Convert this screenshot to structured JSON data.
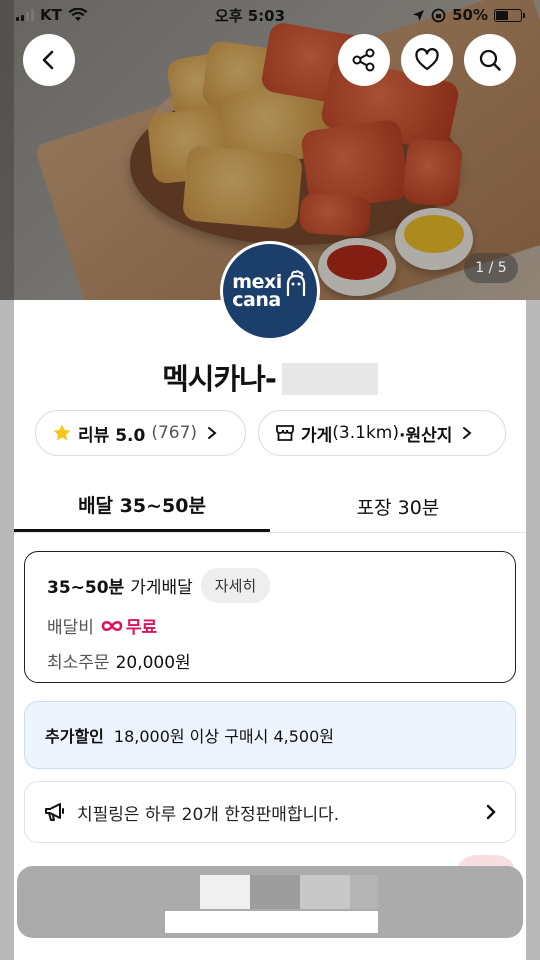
{
  "status_bar": {
    "carrier": "KT",
    "time": "오후 5:03",
    "battery": "50%"
  },
  "hero": {
    "image_counter": "1 / 5"
  },
  "store": {
    "logo_line1": "mexi",
    "logo_line2": "cana",
    "name": "멕시카나-"
  },
  "review_pill": {
    "label": "리뷰 5.0",
    "count": "(767)"
  },
  "store_pill": {
    "label_prefix": "가게",
    "distance": "(3.1km)",
    "label_suffix": "·원산지"
  },
  "tabs": [
    {
      "label": "배달 35~50분"
    },
    {
      "label": "포장 30분"
    }
  ],
  "delivery": {
    "time": "35~50분",
    "type": "가게배달",
    "detail_button": "자세히",
    "fee_label": "배달비",
    "fee_value": "무료",
    "min_order_label": "최소주문",
    "min_order_value": "20,000원"
  },
  "discount": {
    "label": "추가할인",
    "text": "18,000원 이상 구매시 4,500원"
  },
  "notice": {
    "text": "치필링은 하루 20개 한정판매합니다."
  },
  "colors": {
    "accent_pink": "#e0115f",
    "logo_navy": "#1c3e6b",
    "discount_bg": "#eef4fd"
  }
}
